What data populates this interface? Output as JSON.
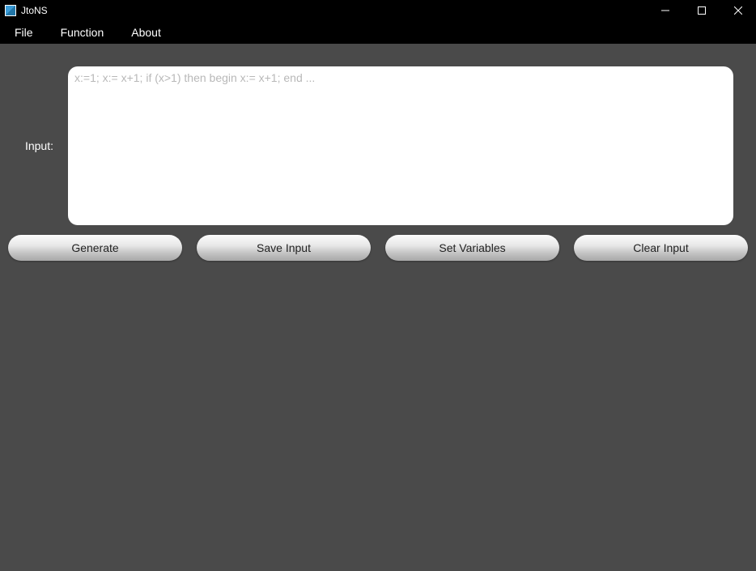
{
  "window": {
    "title": "JtoNS"
  },
  "menu": {
    "items": [
      {
        "label": "File"
      },
      {
        "label": "Function"
      },
      {
        "label": "About"
      }
    ]
  },
  "input": {
    "label": "Input:",
    "placeholder": "x:=1; x:= x+1; if (x>1) then begin x:= x+1; end ...",
    "value": ""
  },
  "buttons": {
    "generate": "Generate",
    "save_input": "Save Input",
    "set_variables": "Set Variables",
    "clear_input": "Clear Input"
  }
}
